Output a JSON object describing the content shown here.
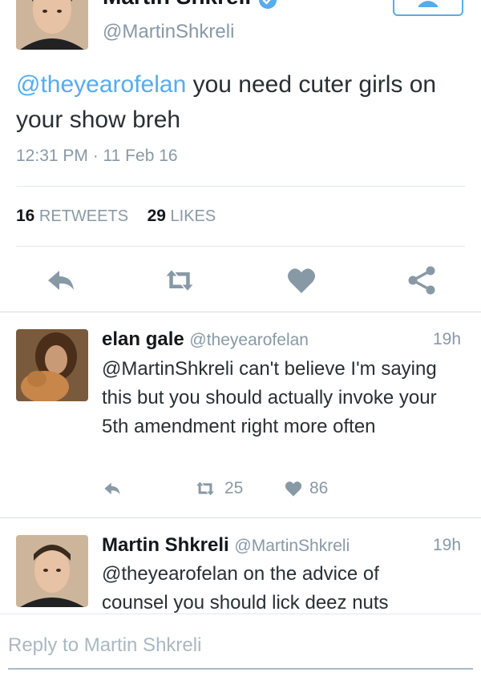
{
  "main_tweet": {
    "author_name": "Martin Shkreli",
    "handle": "@MartinShkreli",
    "mention": "@theyearofelan",
    "text_after_mention": " you need cuter girls on your show breh",
    "timestamp": "12:31 PM · 11 Feb 16",
    "retweets_count": "16",
    "retweets_label": "RETWEETS",
    "likes_count": "29",
    "likes_label": "LIKES"
  },
  "actions": {
    "icons": [
      "reply-icon",
      "retweet-icon",
      "like-icon",
      "share-icon"
    ],
    "accent_color": "#8899a6"
  },
  "replies": [
    {
      "name": "elan gale",
      "handle": "@theyearofelan",
      "time": "19h",
      "text": "@MartinShkreli can't believe I'm saying this but you should actually invoke your 5th amendment right more often",
      "retweets": "25",
      "likes": "86"
    },
    {
      "name": "Martin Shkreli",
      "handle": "@MartinShkreli",
      "time": "19h",
      "text": "@theyearofelan on the advice of counsel you should lick deez nuts"
    }
  ],
  "reply_box": {
    "placeholder": "Reply to Martin Shkreli"
  },
  "colors": {
    "link": "#55acee",
    "muted": "#8899a6",
    "divider": "#e1e8ed"
  }
}
